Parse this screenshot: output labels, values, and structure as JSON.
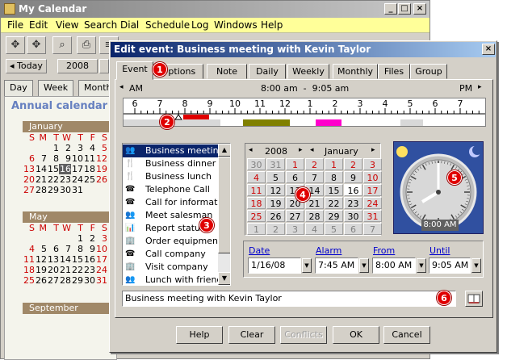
{
  "app": {
    "title": "My Calendar",
    "menu": [
      "File",
      "Edit",
      "View",
      "Search",
      "Dial",
      "Schedule",
      "Log",
      "Windows",
      "Help"
    ],
    "today_label": "Today",
    "year": "2008",
    "view_tabs": [
      "Day",
      "Week",
      "Month"
    ],
    "annual_title": "Annual calendar fo",
    "months": [
      {
        "name": "January",
        "rows": [
          [
            "",
            "",
            "1",
            "2",
            "3",
            "4",
            "5"
          ],
          [
            "6",
            "7",
            "8",
            "9",
            "10",
            "11",
            "12"
          ],
          [
            "13",
            "14",
            "15",
            "16",
            "17",
            "18",
            "19"
          ],
          [
            "20",
            "21",
            "22",
            "23",
            "24",
            "25",
            "26"
          ],
          [
            "27",
            "28",
            "29",
            "30",
            "31",
            "",
            ""
          ]
        ]
      },
      {
        "name": "May",
        "rows": [
          [
            "",
            "",
            "",
            "",
            "1",
            "2",
            "3"
          ],
          [
            "4",
            "5",
            "6",
            "7",
            "8",
            "9",
            "10"
          ],
          [
            "11",
            "12",
            "13",
            "14",
            "15",
            "16",
            "17"
          ],
          [
            "18",
            "19",
            "20",
            "21",
            "22",
            "23",
            "24"
          ],
          [
            "25",
            "26",
            "27",
            "28",
            "29",
            "30",
            "31"
          ]
        ]
      }
    ],
    "weekday_header": [
      "S",
      "M",
      "T",
      "W",
      "T",
      "F",
      "S"
    ],
    "september": "September"
  },
  "dialog": {
    "title": "Edit event: Business meeting with Kevin Taylor",
    "tabs": [
      "Event",
      "Options",
      "Note",
      "Daily",
      "Weekly",
      "Monthly",
      "Files",
      "Group"
    ],
    "timeline": {
      "am": "AM",
      "pm": "PM",
      "range": "8:00 am  -  9:05 am",
      "hours": [
        "6",
        "7",
        "8",
        "9",
        "10",
        "11",
        "12",
        "1",
        "2",
        "3",
        "4",
        "5",
        "6",
        "7"
      ]
    },
    "event_types": [
      "Business meeting",
      "Business dinner",
      "Business lunch",
      "Telephone Call",
      "Call for information",
      "Meet salesman",
      "Report status",
      "Order equipment",
      "Call company",
      "Visit company",
      "Lunch with friend"
    ],
    "calendar": {
      "year": "2008",
      "month": "January",
      "rows": [
        [
          "30",
          "31",
          "1",
          "2",
          "1",
          "2",
          "3"
        ],
        [
          "4",
          "5",
          "6",
          "7",
          "8",
          "9",
          "10"
        ],
        [
          "11",
          "12",
          "13",
          "14",
          "15",
          "16",
          "17"
        ],
        [
          "18",
          "19",
          "20",
          "21",
          "22",
          "23",
          "24"
        ],
        [
          "25",
          "26",
          "27",
          "28",
          "29",
          "30",
          "31"
        ],
        [
          "1",
          "2",
          "3",
          "4",
          "5",
          "6",
          "7"
        ]
      ]
    },
    "clock": {
      "time": "8:00 AM"
    },
    "fields": {
      "date_label": "Date",
      "date": "1/16/08",
      "alarm_label": "Alarm",
      "alarm": "7:45 AM",
      "from_label": "From",
      "from": "8:00 AM",
      "until_label": "Until",
      "until": "9:05 AM"
    },
    "subject": "Business meeting with Kevin Taylor",
    "buttons": {
      "help": "Help",
      "clear": "Clear",
      "conflicts": "Conflicts",
      "ok": "OK",
      "cancel": "Cancel"
    },
    "callouts": [
      "1",
      "2",
      "3",
      "4",
      "5",
      "6"
    ]
  },
  "colors": {
    "title_active": "#0a246a",
    "menubar": "#ffff99",
    "bar_red": "#e00000",
    "bar_olive": "#808000",
    "bar_magenta": "#ff00cc",
    "callout": "#e00000"
  }
}
